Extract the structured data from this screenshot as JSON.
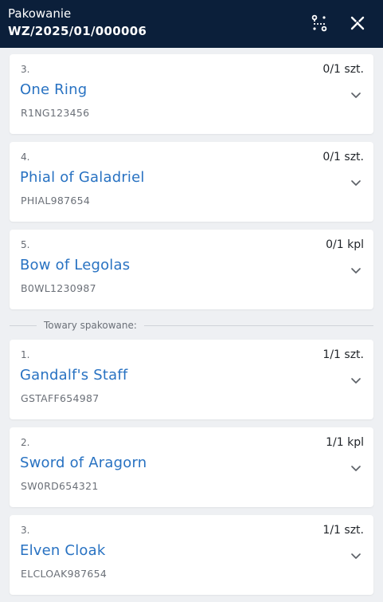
{
  "header": {
    "title": "Pakowanie",
    "document_number": "WZ/2025/01/000006"
  },
  "pending_items": [
    {
      "index": "3.",
      "name": "One Ring",
      "code": "R1NG123456",
      "quantity": "0/1 szt."
    },
    {
      "index": "4.",
      "name": "Phial of Galadriel",
      "code": "PHIAL987654",
      "quantity": "0/1 szt."
    },
    {
      "index": "5.",
      "name": "Bow of Legolas",
      "code": "B0WL1230987",
      "quantity": "0/1 kpl"
    }
  ],
  "packed_section": {
    "label": "Towary spakowane:"
  },
  "packed_items": [
    {
      "index": "1.",
      "name": "Gandalf's Staff",
      "code": "GSTAFF654987",
      "quantity": "1/1 szt."
    },
    {
      "index": "2.",
      "name": "Sword of Aragorn",
      "code": "SW0RD654321",
      "quantity": "1/1 kpl"
    },
    {
      "index": "3.",
      "name": "Elven Cloak",
      "code": "ELCLOAK987654",
      "quantity": "1/1 szt."
    }
  ],
  "colors": {
    "header_bg": "#0b1f3a",
    "item_name": "#2872c2",
    "page_bg": "#eef0f3"
  },
  "icons": {
    "route": "route-icon",
    "close": "close-x-icon",
    "expand": "chevron-down-icon"
  }
}
